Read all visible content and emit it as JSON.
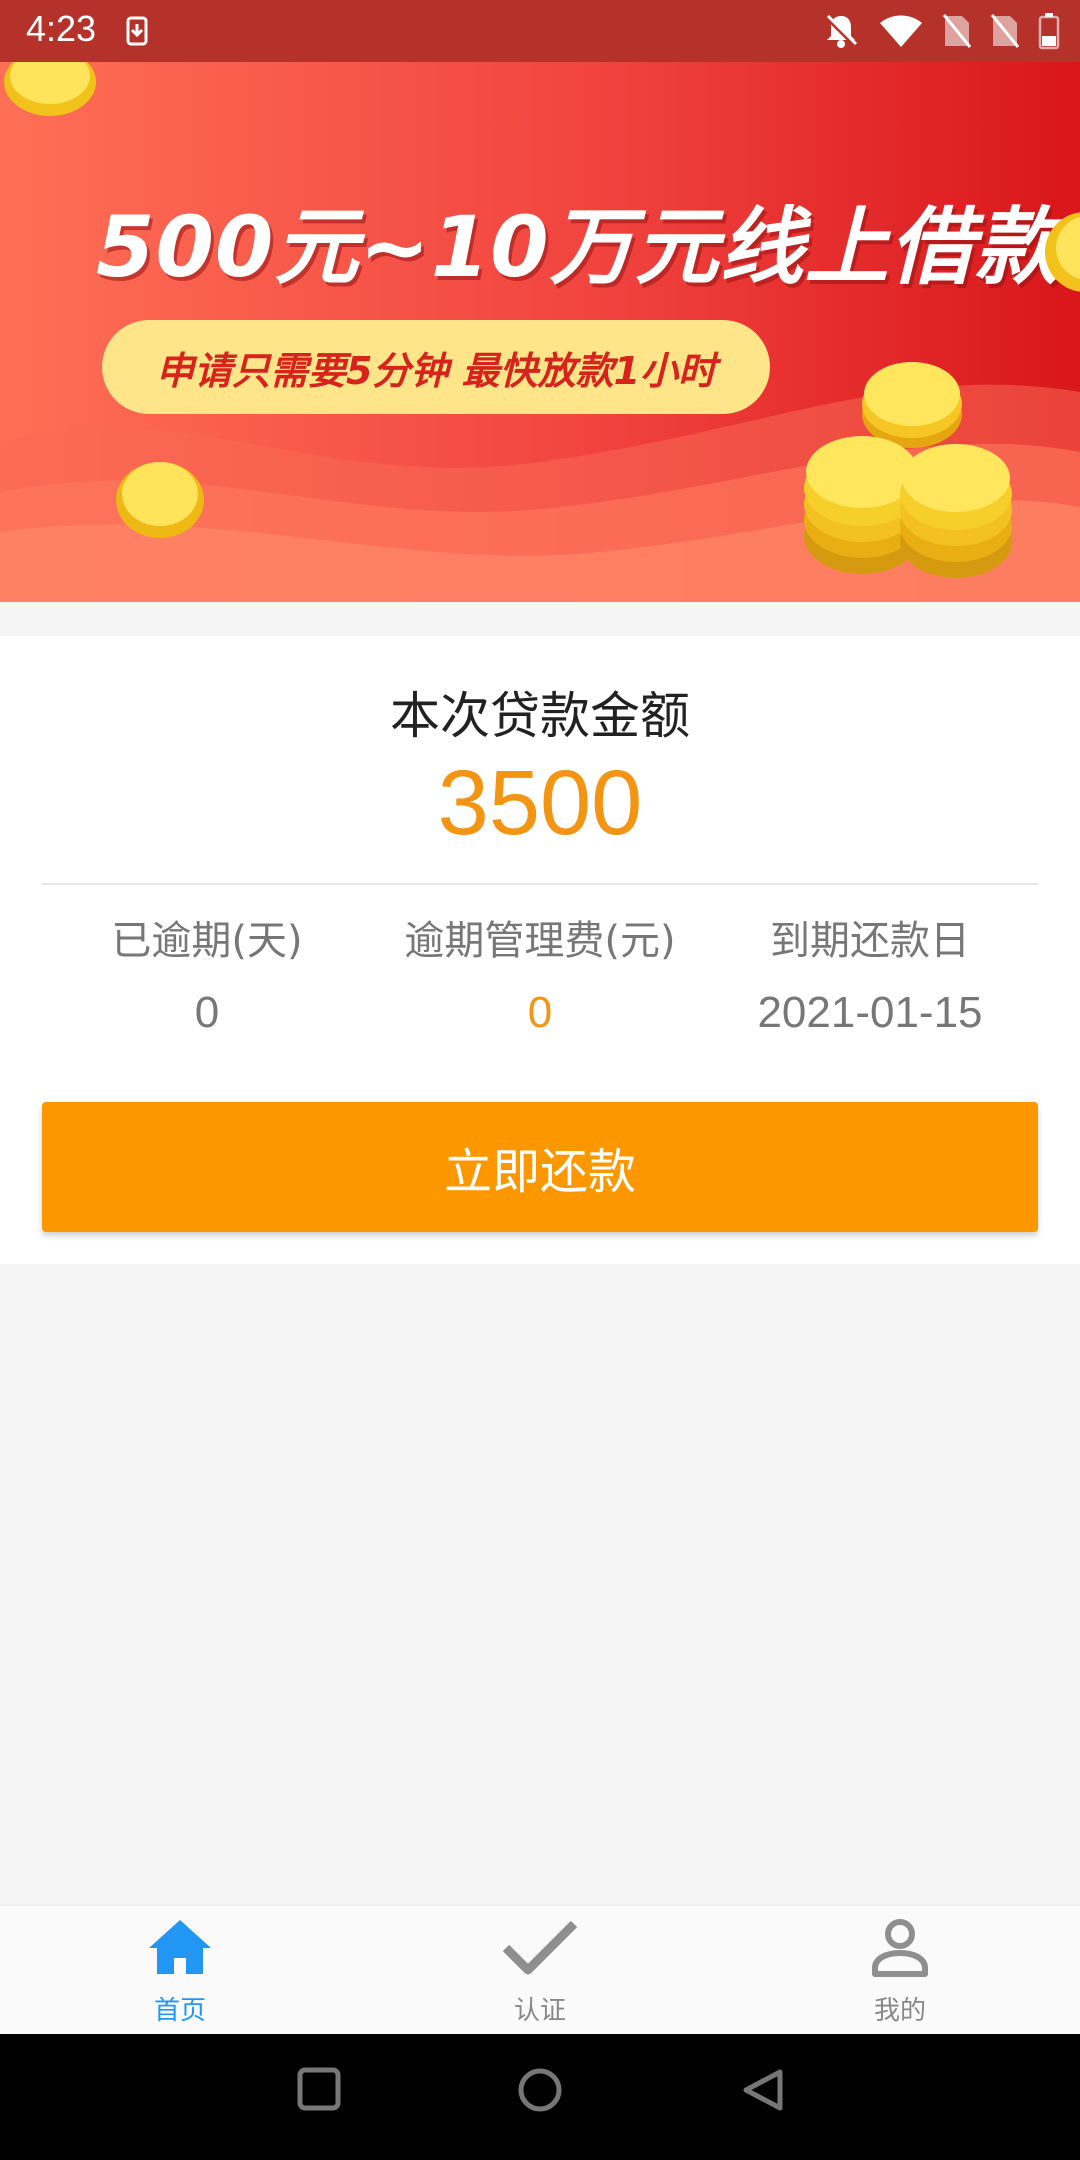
{
  "status_bar": {
    "time": "4:23",
    "background": "#b5322b"
  },
  "banner": {
    "title": "500元~10万元线上借款",
    "subtitle": "申请只需要5分钟 最快放款1小时"
  },
  "loan_card": {
    "title": "本次贷款金额",
    "amount": "3500",
    "stats": [
      {
        "label": "已逾期(天)",
        "value": "0"
      },
      {
        "label": "逾期管理费(元)",
        "value": "0"
      },
      {
        "label": "到期还款日",
        "value": "2021-01-15"
      }
    ],
    "repay_button": "立即还款"
  },
  "bottom_nav": {
    "items": [
      {
        "label": "首页",
        "icon": "home-icon",
        "active": true
      },
      {
        "label": "认证",
        "icon": "check-icon",
        "active": false
      },
      {
        "label": "我的",
        "icon": "person-icon",
        "active": false
      }
    ]
  },
  "colors": {
    "accent_orange": "#f39412",
    "button_orange": "#fd9700",
    "nav_active_blue": "#2196f3",
    "banner_red": "#e8352f"
  }
}
